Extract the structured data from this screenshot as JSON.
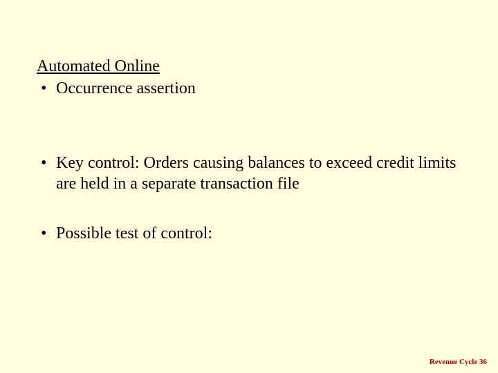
{
  "slide": {
    "heading": "Automated Online",
    "bullets": [
      {
        "text": "Occurrence assertion"
      },
      {
        "text": "Key control: Orders causing balances to exceed credit limits are held in a separate transaction file"
      },
      {
        "text": "Possible test of control:"
      }
    ],
    "bullet_glyph": "•"
  },
  "footer": {
    "label": "Revenue Cycle",
    "page": "36"
  }
}
